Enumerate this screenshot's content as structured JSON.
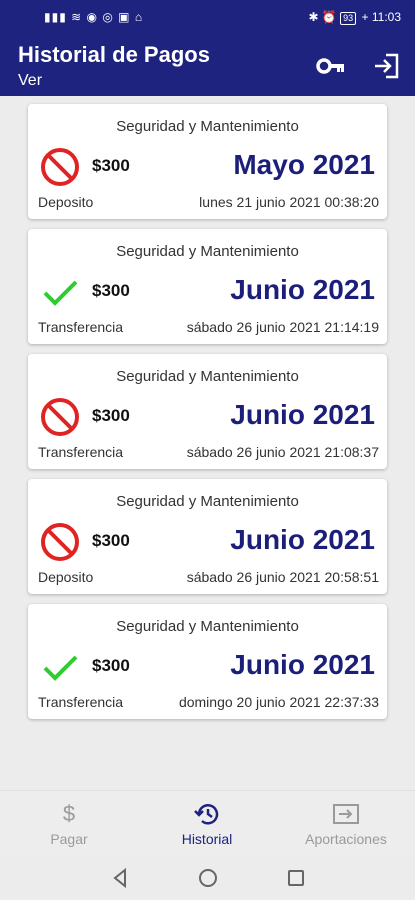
{
  "status_bar": {
    "left_icons": "▮▮▮ ≋ ◉ ◎ ▣ ⌂",
    "right_icons": "✱ ⏰",
    "battery": "93",
    "time": "+ 11:03"
  },
  "app_bar": {
    "title": "Historial de Pagos",
    "subtitle": "Ver",
    "key_icon": "key-icon",
    "exit_icon": "logout-icon"
  },
  "payments": [
    {
      "concept": "Seguridad y Mantenimiento",
      "status": "rejected",
      "amount": "$300",
      "period": "Mayo 2021",
      "method": "Deposito",
      "date": "lunes 21 junio 2021 00:38:20"
    },
    {
      "concept": "Seguridad y Mantenimiento",
      "status": "approved",
      "amount": "$300",
      "period": "Junio 2021",
      "method": "Transferencia",
      "date": "sábado 26 junio 2021 21:14:19"
    },
    {
      "concept": "Seguridad y Mantenimiento",
      "status": "rejected",
      "amount": "$300",
      "period": "Junio 2021",
      "method": "Transferencia",
      "date": "sábado 26 junio 2021 21:08:37"
    },
    {
      "concept": "Seguridad y Mantenimiento",
      "status": "rejected",
      "amount": "$300",
      "period": "Junio 2021",
      "method": "Deposito",
      "date": "sábado 26 junio 2021 20:58:51"
    },
    {
      "concept": "Seguridad y Mantenimiento",
      "status": "approved",
      "amount": "$300",
      "period": "Junio 2021",
      "method": "Transferencia",
      "date": "domingo 20 junio 2021 22:37:33"
    }
  ],
  "bottom_nav": {
    "pagar": {
      "label": "Pagar",
      "icon": "dollar-icon",
      "dollar": "$"
    },
    "historial": {
      "label": "Historial",
      "icon": "history-icon"
    },
    "aportaciones": {
      "label": "Aportaciones",
      "icon": "login-icon"
    }
  },
  "colors": {
    "primary": "#1d237f",
    "rejected": "#e02424",
    "approved": "#2ecc2e",
    "inactive": "#9a9a9a"
  }
}
